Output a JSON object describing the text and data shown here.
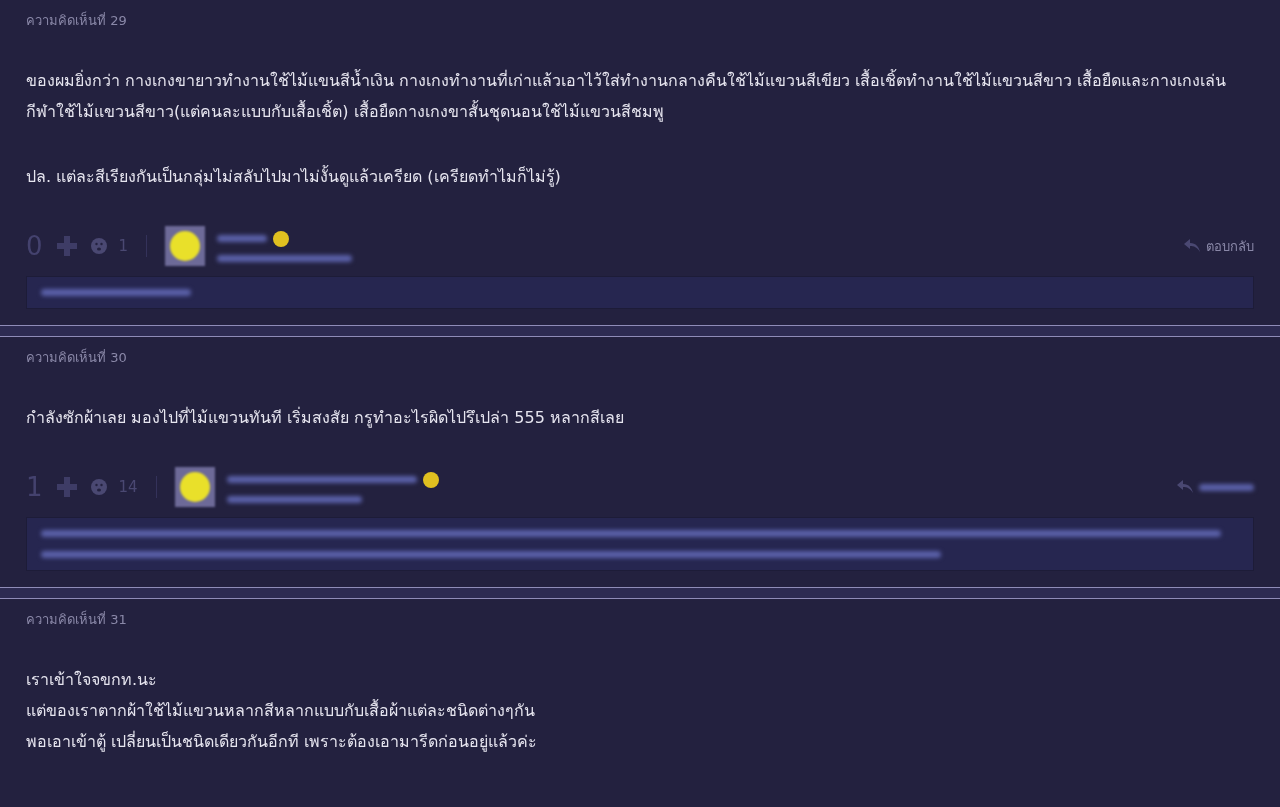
{
  "comments": [
    {
      "header": "ความคิดเห็นที่ 29",
      "paragraphs": [
        "ของผมยิ่งกว่า กางเกงขายาวทำงานใช้ไม้แขนสีน้ำเงิน กางเกงทำงานที่เก่าแล้วเอาไว้ใส่ทำงานกลางคืนใช้ไม้แขวนสีเขียว เสื้อเชิ้ตทำงานใช้ไม้แขวนสีขาว เสื้อยืดและกางเกงเล่นกีฬาใช้ไม้แขวนสีขาว(แต่คนละแบบกับเสื้อเชิ้ต) เสื้อยืดกางเกงขาสั้นชุดนอนใช้ไม้แขวนสีชมพู",
        "ปล. แต่ละสีเรียงกันเป็นกลุ่มไม่สลับไปมาไม่งั้นดูแล้วเครียด (เครียดทำไมก็ไม่รู้)"
      ],
      "footer": {
        "votes": "0",
        "emotions": "1",
        "reply": "ตอบกลับ",
        "quote": {
          "kind": "short"
        }
      }
    },
    {
      "header": "ความคิดเห็นที่ 30",
      "paragraphs": [
        "กำลังซักผ้าเลย มองไปที่ไม้แขวนทันที เริ่มสงสัย กรูทำอะไรผิดไปรึเปล่า 555  หลากสีเลย"
      ],
      "footer": {
        "votes": "1",
        "emotions": "14",
        "quote": {
          "kind": "long"
        }
      }
    },
    {
      "header": "ความคิดเห็นที่ 31",
      "paragraphs": [
        "เราเข้าใจจขกท.นะ\nแต่ของเราตากผ้าใช้ไม้แขวนหลากสีหลากแบบกับเสื้อผ้าแต่ละชนิดต่างๆกัน\nพอเอาเข้าตู้ เปลี่ยนเป็นชนิดเดียวกันอีกที เพราะต้องเอามารีดก่อนอยู่แล้วค่ะ"
      ]
    }
  ]
}
